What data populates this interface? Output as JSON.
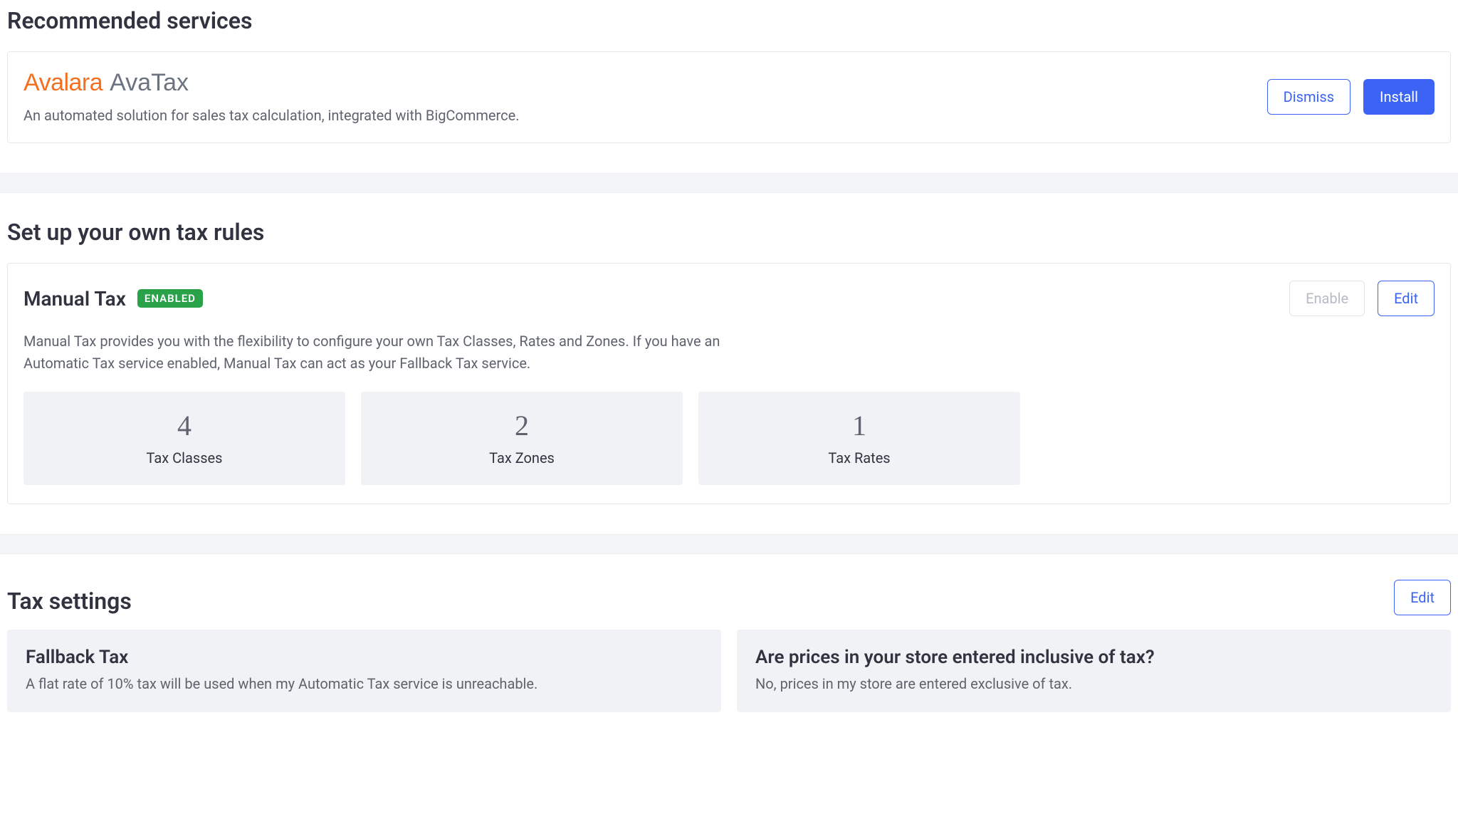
{
  "recommended": {
    "heading": "Recommended services",
    "logo_brand": "Avalara",
    "logo_product": "AvaTax",
    "description": "An automated solution for sales tax calculation, integrated with BigCommerce.",
    "dismiss_label": "Dismiss",
    "install_label": "Install"
  },
  "manual": {
    "heading": "Set up your own tax rules",
    "title": "Manual Tax",
    "badge": "ENABLED",
    "enable_label": "Enable",
    "edit_label": "Edit",
    "description": "Manual Tax provides you with the flexibility to configure your own Tax Classes, Rates and Zones. If you have an Automatic Tax service enabled, Manual Tax can act as your Fallback Tax service.",
    "stats": [
      {
        "value": "4",
        "label": "Tax Classes"
      },
      {
        "value": "2",
        "label": "Tax Zones"
      },
      {
        "value": "1",
        "label": "Tax Rates"
      }
    ]
  },
  "settings": {
    "heading": "Tax settings",
    "edit_label": "Edit",
    "cards": [
      {
        "title": "Fallback Tax",
        "desc": "A flat rate of 10% tax will be used when my Automatic Tax service is unreachable."
      },
      {
        "title": "Are prices in your store entered inclusive of tax?",
        "desc": "No, prices in my store are entered exclusive of tax."
      }
    ]
  }
}
